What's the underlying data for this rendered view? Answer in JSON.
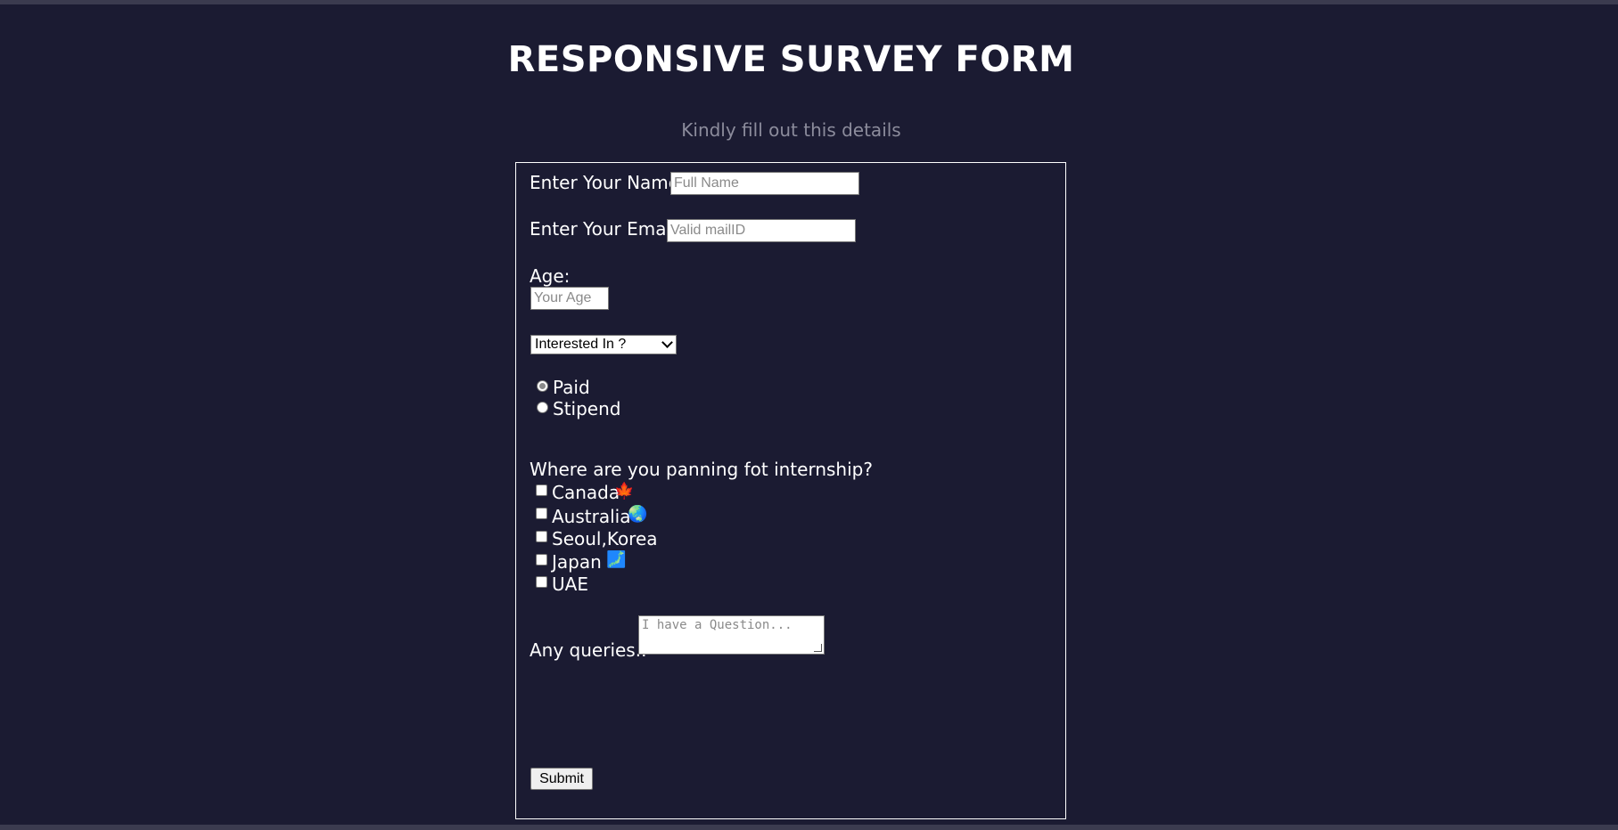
{
  "page": {
    "title": "RESPONSIVE SURVEY FORM",
    "subtitle": "Kindly fill out this details"
  },
  "form": {
    "name_label": "Enter Your Name:",
    "name_placeholder": "Full Name",
    "email_label": "Enter Your Email:",
    "email_placeholder": "Valid mailID",
    "age_label": "Age:",
    "age_placeholder": "Your Age",
    "interest_select": {
      "selected": "Interested In ?"
    },
    "payment_options": [
      {
        "label": "Paid",
        "checked": true
      },
      {
        "label": "Stipend",
        "checked": false
      }
    ],
    "location_question": "Where are you panning fot internship?",
    "locations": [
      {
        "label": "Canada",
        "emoji": "🍁",
        "icon": "maple-leaf-icon"
      },
      {
        "label": "Australia",
        "emoji": "🌏",
        "icon": "globe-icon"
      },
      {
        "label": "Seoul,Korea",
        "emoji": "",
        "icon": ""
      },
      {
        "label": "Japan",
        "emoji": "🗾",
        "icon": "japan-map-icon"
      },
      {
        "label": "UAE",
        "emoji": "",
        "icon": ""
      }
    ],
    "queries_label": "Any queries..",
    "queries_placeholder": "I have a Question...",
    "submit_label": "Submit"
  },
  "colors": {
    "background": "#1b1b32",
    "text": "#ffffff",
    "subtitle": "#8c8c9c"
  }
}
